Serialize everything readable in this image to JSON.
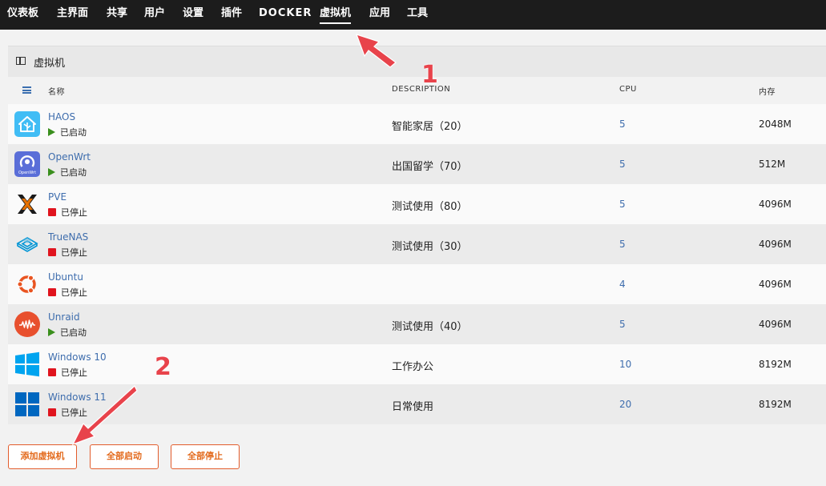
{
  "nav": {
    "items": [
      "仪表板",
      "主界面",
      "共享",
      "用户",
      "设置",
      "插件",
      "DOCKER",
      "虚拟机",
      "应用",
      "工具"
    ],
    "active": "虚拟机"
  },
  "panel": {
    "title": "虚拟机"
  },
  "table": {
    "headers": {
      "name": "名称",
      "description": "DESCRIPTION",
      "cpu": "CPU",
      "memory": "内存"
    },
    "rows": [
      {
        "name": "HAOS",
        "status": "已启动",
        "state": "running",
        "description": "智能家居（20）",
        "cpu": "5",
        "memory": "2048M",
        "icon": "home-assistant-icon"
      },
      {
        "name": "OpenWrt",
        "status": "已启动",
        "state": "running",
        "description": "出国留学（70）",
        "cpu": "5",
        "memory": "512M",
        "icon": "openwrt-icon",
        "icon_text": "OpenWrt"
      },
      {
        "name": "PVE",
        "status": "已停止",
        "state": "stopped",
        "description": "测试使用（80）",
        "cpu": "5",
        "memory": "4096M",
        "icon": "proxmox-icon"
      },
      {
        "name": "TrueNAS",
        "status": "已停止",
        "state": "stopped",
        "description": "测试使用（30）",
        "cpu": "5",
        "memory": "4096M",
        "icon": "truenas-icon"
      },
      {
        "name": "Ubuntu",
        "status": "已停止",
        "state": "stopped",
        "description": "",
        "cpu": "4",
        "memory": "4096M",
        "icon": "ubuntu-icon"
      },
      {
        "name": "Unraid",
        "status": "已启动",
        "state": "running",
        "description": "测试使用（40）",
        "cpu": "5",
        "memory": "4096M",
        "icon": "unraid-icon"
      },
      {
        "name": "Windows 10",
        "status": "已停止",
        "state": "stopped",
        "description": "工作办公",
        "cpu": "10",
        "memory": "8192M",
        "icon": "windows-10-icon"
      },
      {
        "name": "Windows 11",
        "status": "已停止",
        "state": "stopped",
        "description": "日常使用",
        "cpu": "20",
        "memory": "8192M",
        "icon": "windows-11-icon"
      }
    ]
  },
  "buttons": {
    "add": "添加虚拟机",
    "start_all": "全部启动",
    "stop_all": "全部停止"
  },
  "annotations": {
    "one": "1",
    "two": "2"
  },
  "colors": {
    "accent": "#e35c2c",
    "link": "#3e6dad",
    "running": "#3a8f1d",
    "stopped": "#e0141e",
    "callout": "#e8434b"
  }
}
